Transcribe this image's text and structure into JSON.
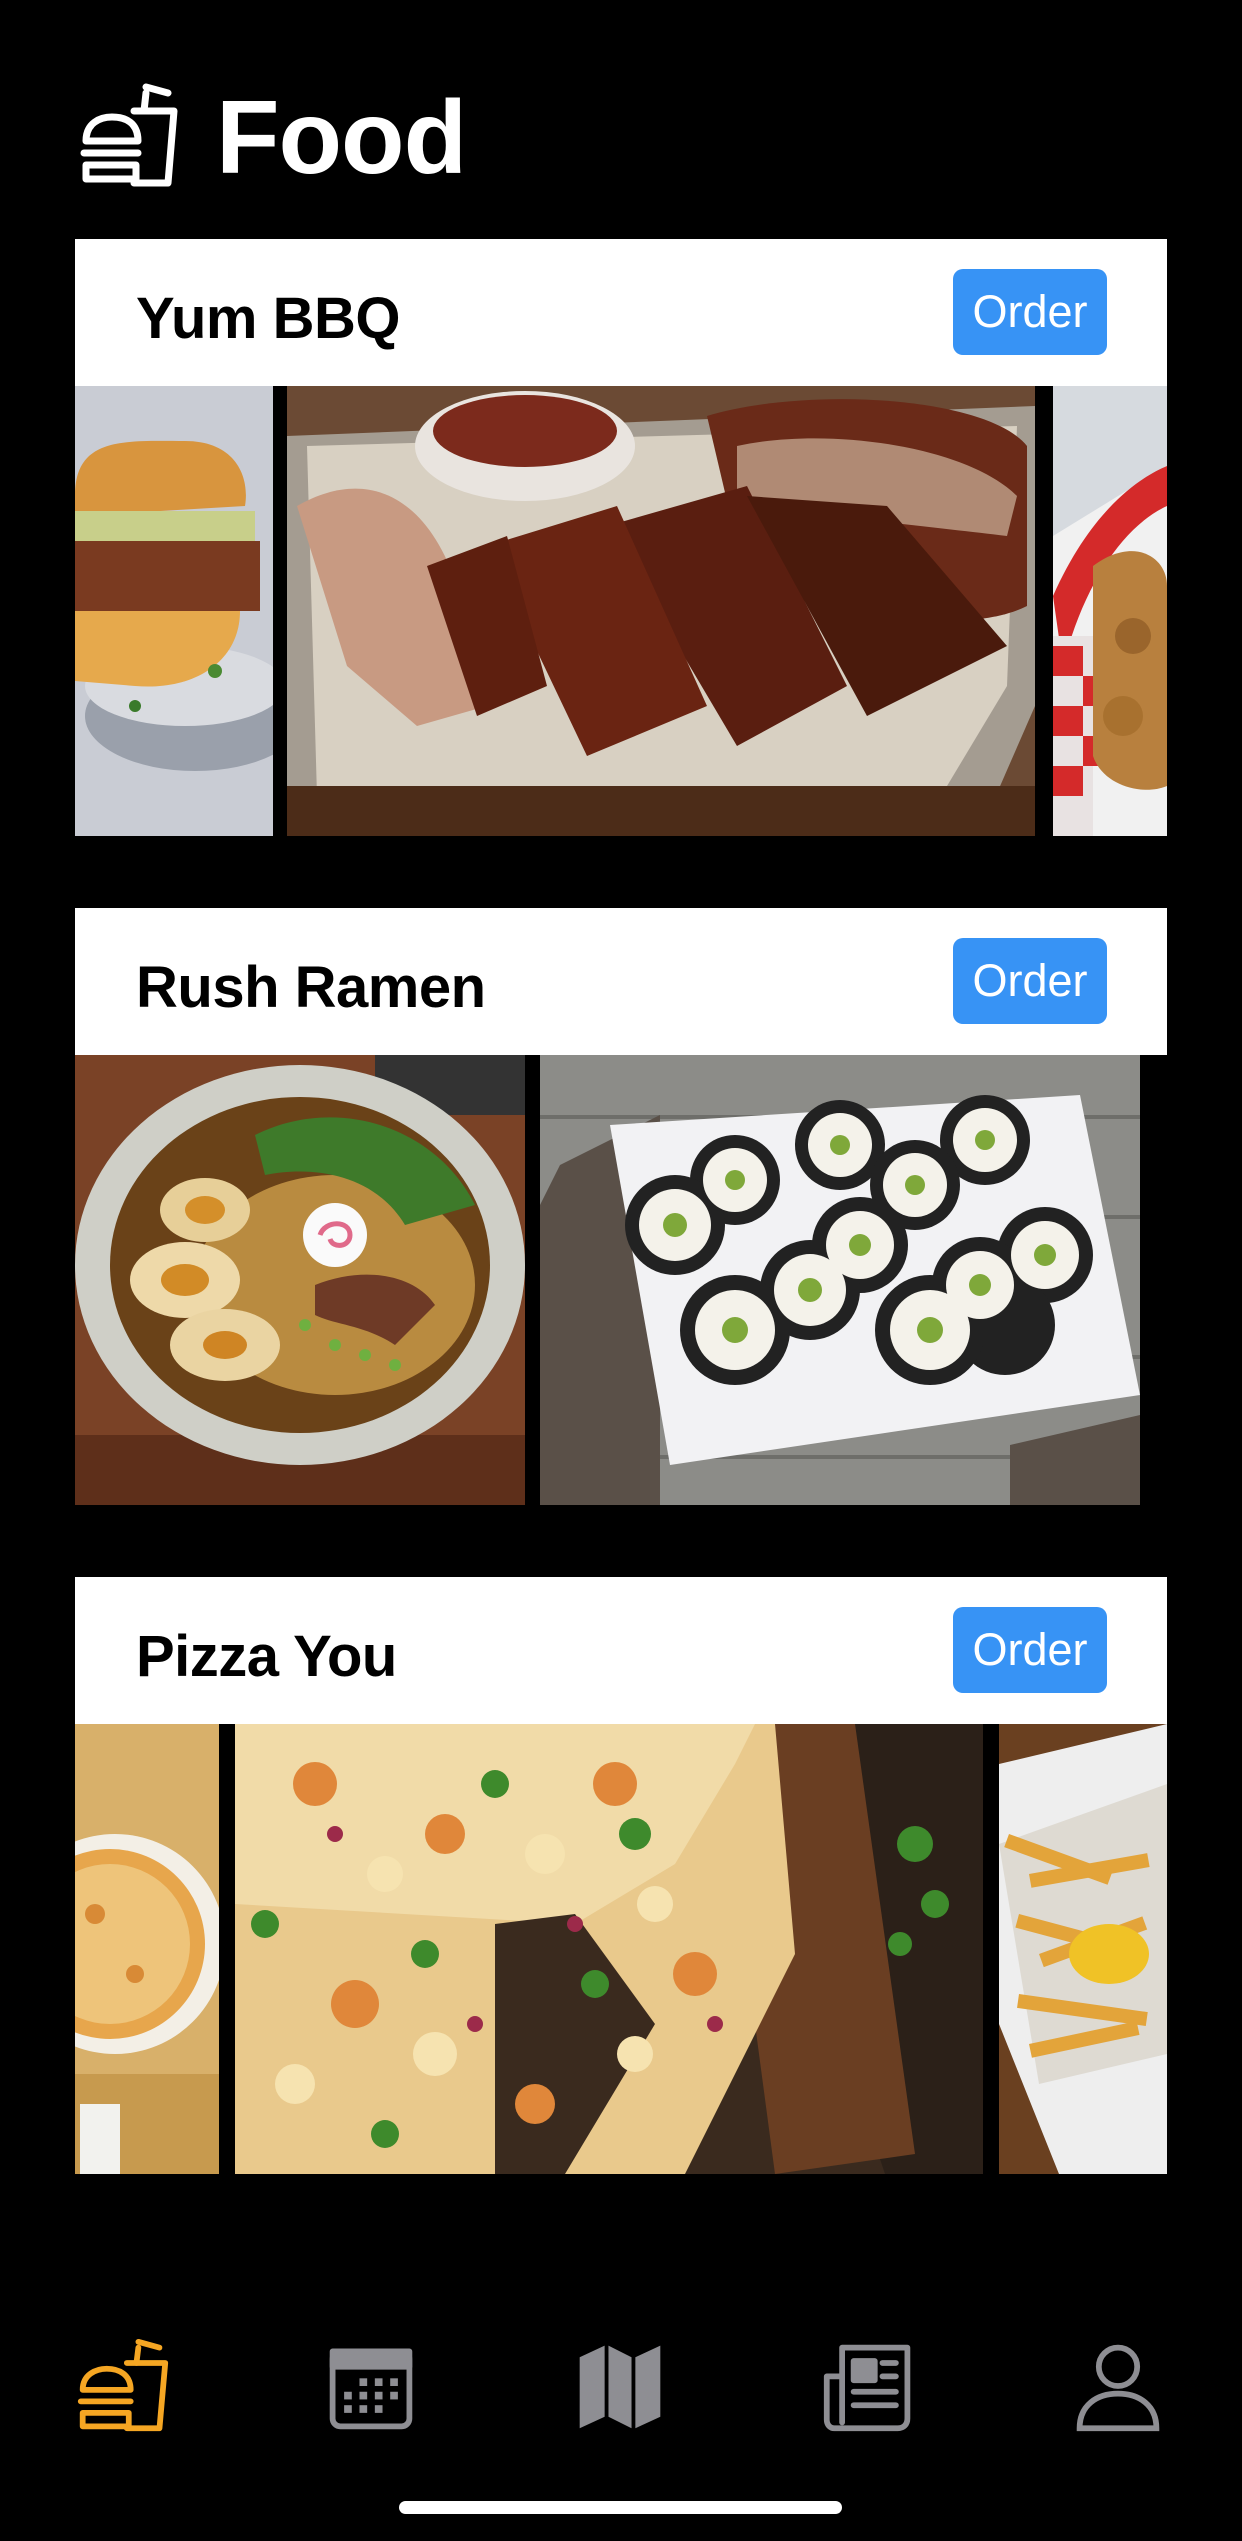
{
  "header": {
    "title": "Food",
    "icon": "burger-drink-icon"
  },
  "restaurants": [
    {
      "name": "Yum BBQ",
      "order_label": "Order",
      "photos": [
        "pulled-pork-sandwich",
        "bbq-ribs",
        "fried-chicken-basket"
      ]
    },
    {
      "name": "Rush Ramen",
      "order_label": "Order",
      "photos": [
        "ramen-bowl",
        "sushi-rolls"
      ]
    },
    {
      "name": "Pizza You",
      "order_label": "Order",
      "photos": [
        "cheese-pizza",
        "bbq-chicken-pizza",
        "fries"
      ]
    }
  ],
  "tabbar": {
    "items": [
      {
        "name": "food",
        "icon": "burger-drink-icon",
        "active": true
      },
      {
        "name": "calendar",
        "icon": "calendar-icon",
        "active": false
      },
      {
        "name": "map",
        "icon": "map-icon",
        "active": false
      },
      {
        "name": "news",
        "icon": "newspaper-icon",
        "active": false
      },
      {
        "name": "profile",
        "icon": "person-icon",
        "active": false
      }
    ],
    "active_color": "#f5a623",
    "inactive_color": "#8e8e93"
  },
  "colors": {
    "background": "#000000",
    "card": "#ffffff",
    "accent": "#3793f5"
  }
}
